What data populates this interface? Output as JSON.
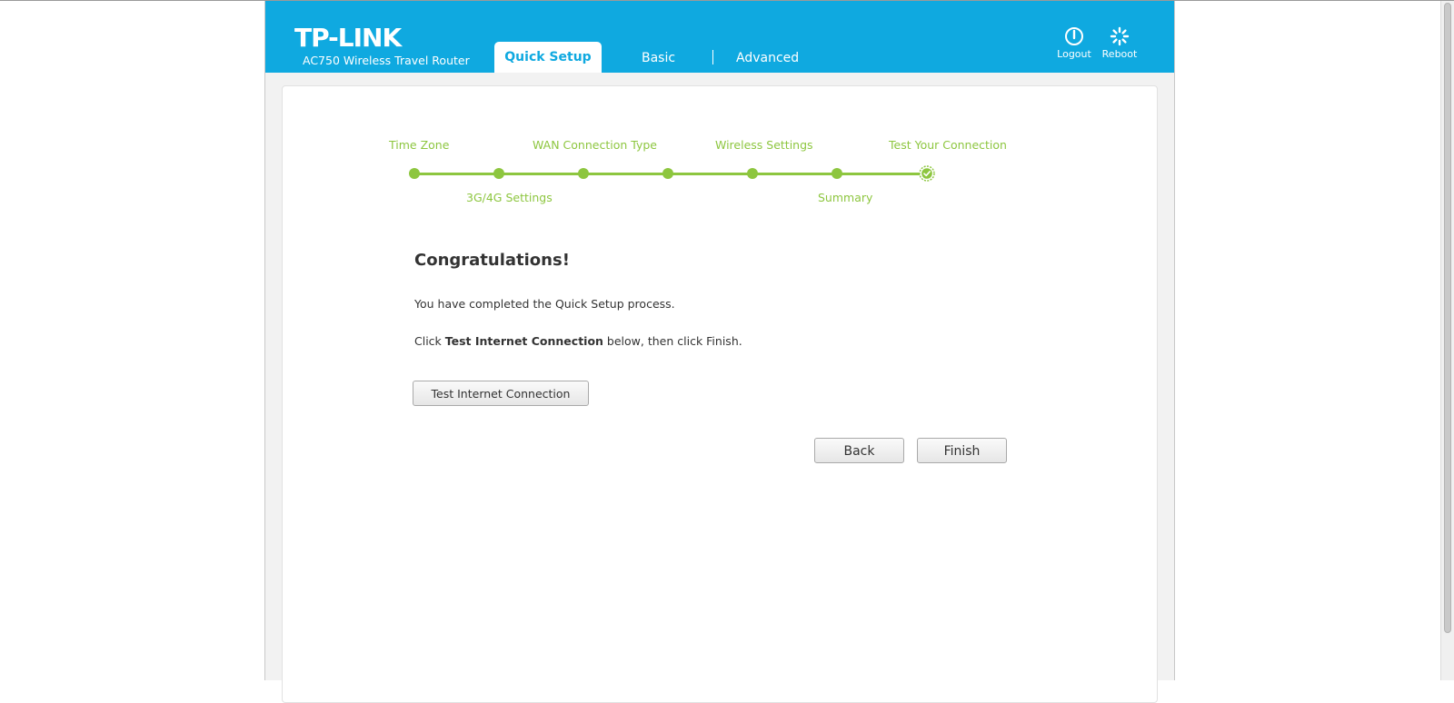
{
  "header": {
    "logo": "TP-LINK",
    "model": "AC750 Wireless Travel Router",
    "tabs": {
      "quick_setup": "Quick Setup",
      "basic": "Basic",
      "advanced": "Advanced"
    },
    "actions": {
      "logout": "Logout",
      "reboot": "Reboot"
    },
    "accent_color": "#0fa9e0"
  },
  "steps": {
    "color": "#8dc63f",
    "top_labels": [
      "Time Zone",
      "WAN Connection Type",
      "Wireless Settings",
      "Test Your Connection"
    ],
    "bottom_labels": [
      "3G/4G Settings",
      "Summary"
    ],
    "current": "Test Your Connection"
  },
  "content": {
    "title": "Congratulations!",
    "line1": "You have completed the Quick Setup process.",
    "line2_prefix": "Click ",
    "line2_bold": "Test Internet Connection",
    "line2_suffix": " below, then click Finish."
  },
  "buttons": {
    "test": "Test Internet Connection",
    "back": "Back",
    "finish": "Finish"
  },
  "icons": {
    "logout": "power-icon",
    "reboot": "reboot-spinner-icon",
    "current_step": "check-circle-icon"
  }
}
